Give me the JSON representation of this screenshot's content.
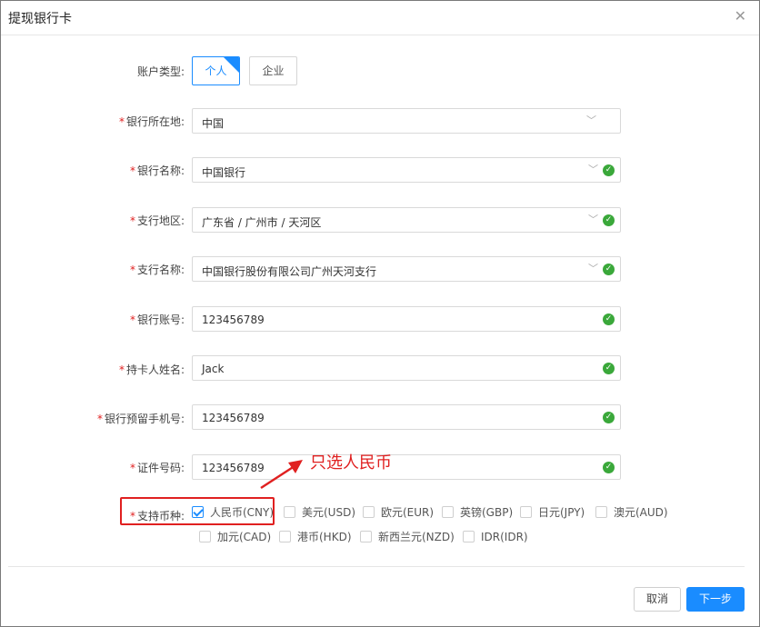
{
  "dialog": {
    "title": "提现银行卡"
  },
  "account_type": {
    "label": "账户类型:",
    "options": [
      {
        "label": "个人",
        "selected": true
      },
      {
        "label": "企业",
        "selected": false
      }
    ]
  },
  "fields": [
    {
      "label": "银行所在地:",
      "required": true,
      "value": "中国",
      "type": "select",
      "valid": false
    },
    {
      "label": "银行名称:",
      "required": true,
      "value": "中国银行",
      "type": "select",
      "valid": true
    },
    {
      "label": "支行地区:",
      "required": true,
      "value": "广东省 / 广州市 / 天河区",
      "type": "select",
      "valid": true
    },
    {
      "label": "支行名称:",
      "required": true,
      "value": "中国银行股份有限公司广州天河支行",
      "type": "select",
      "valid": true
    },
    {
      "label": "银行账号:",
      "required": true,
      "value": "123456789",
      "type": "input",
      "valid": true
    },
    {
      "label": "持卡人姓名:",
      "required": true,
      "value": "Jack",
      "type": "input",
      "valid": true
    },
    {
      "label": "银行预留手机号:",
      "required": true,
      "value": "123456789",
      "type": "input",
      "valid": true
    },
    {
      "label": "证件号码:",
      "required": true,
      "value": "123456789",
      "type": "input",
      "valid": true
    }
  ],
  "required_mark": "*",
  "currency": {
    "label": "支持币种:",
    "options": [
      {
        "label": "人民币(CNY)",
        "checked": true
      },
      {
        "label": "美元(USD)",
        "checked": false
      },
      {
        "label": "欧元(EUR)",
        "checked": false
      },
      {
        "label": "英镑(GBP)",
        "checked": false
      },
      {
        "label": "日元(JPY)",
        "checked": false
      },
      {
        "label": "澳元(AUD)",
        "checked": false
      },
      {
        "label": "加元(CAD)",
        "checked": false
      },
      {
        "label": "港币(HKD)",
        "checked": false
      },
      {
        "label": "新西兰元(NZD)",
        "checked": false
      },
      {
        "label": "IDR(IDR)",
        "checked": false
      }
    ]
  },
  "annotation": {
    "text": "只选人民币",
    "color": "#e02020"
  },
  "footer": {
    "cancel_label": "取消",
    "next_label": "下一步"
  },
  "icons": {
    "close": "close-icon",
    "chevron": "chevron-down-icon",
    "valid": "check-circle-icon"
  },
  "colors": {
    "accent": "#1a8cff",
    "success": "#3aa83a",
    "required": "#e02020"
  }
}
